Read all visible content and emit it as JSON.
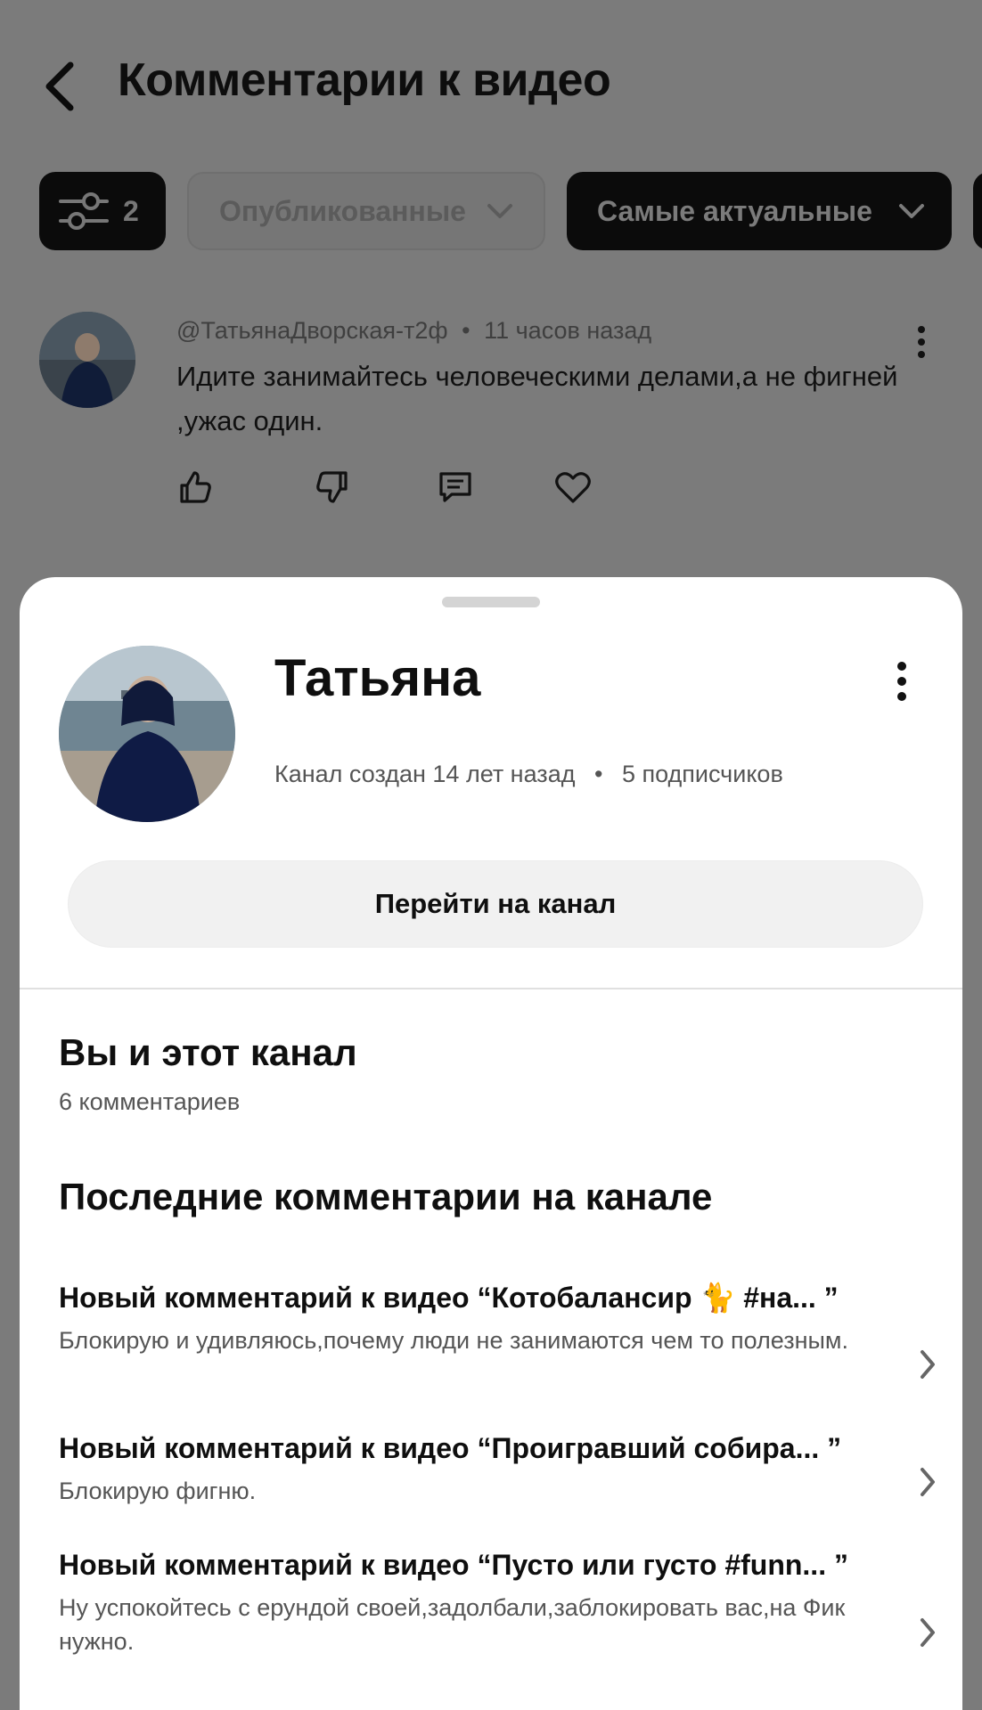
{
  "header": {
    "title": "Комментарии к видео"
  },
  "filters": {
    "count": "2",
    "published_label": "Опубликованные",
    "sort_label": "Самые актуальные"
  },
  "comment": {
    "author": "@ТатьянаДворская-т2ф",
    "separator": "•",
    "time": "11 часов назад",
    "text": "Идите занимайтесь человеческими делами,а не фигней ,ужас один."
  },
  "profile": {
    "name": "Татьяна",
    "created": "Канал создан 14 лет назад",
    "separator": "•",
    "subscribers": "5 подписчиков",
    "goto_label": "Перейти на канал"
  },
  "you_and_channel": {
    "title": "Вы и этот канал",
    "comments_count": "6 комментариев"
  },
  "recent": {
    "title": "Последние комментарии на канале",
    "items": [
      {
        "title": "Новый комментарий к видео “Котобалансир 🐈 #на... ”",
        "text": "Блокирую и удивляюсь,почему люди не занимаются чем то полезным."
      },
      {
        "title": "Новый комментарий к видео “Проигравший собира... ”",
        "text": "Блокирую фигню."
      },
      {
        "title": "Новый комментарий к видео “Пусто или густо #funn... ”",
        "text": "Ну успокойтесь с ерундой своей,задолбали,заблокировать вас,на Фик нужно."
      }
    ]
  },
  "colors": {
    "overlay": "#7b7b7b",
    "sheet": "#ffffff",
    "button": "#f1f1f1",
    "text": "#0f0f0f",
    "muted": "#555555"
  }
}
